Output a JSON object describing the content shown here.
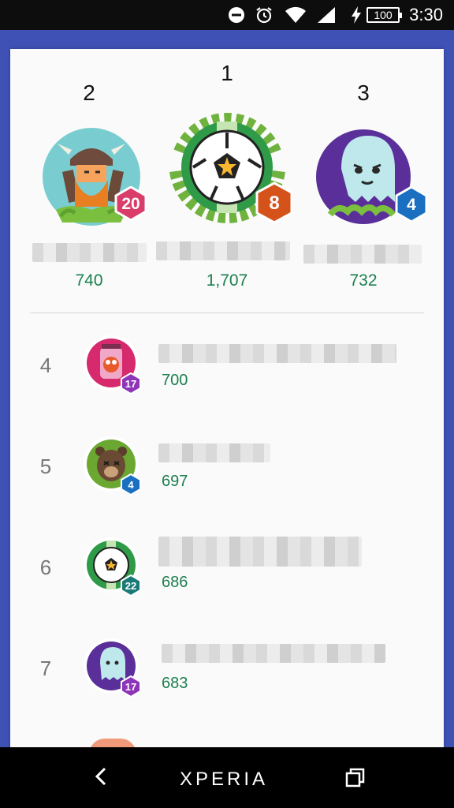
{
  "status_bar": {
    "time": "3:30",
    "battery": "100",
    "icons": [
      "do-not-disturb-icon",
      "alarm-icon",
      "wifi-icon",
      "signal-icon",
      "charging-icon"
    ]
  },
  "colors": {
    "accent": "#3f51b5",
    "score_green": "#1b7f4e",
    "badge_red": "#d93d6a",
    "badge_orange": "#d5531a",
    "badge_blue": "#1a6fc0",
    "badge_purple": "#8e34b8",
    "badge_teal": "#1a7a78"
  },
  "podium": [
    {
      "rank": "2",
      "score": "740",
      "level": "20",
      "avatar": "viking-avatar"
    },
    {
      "rank": "1",
      "score": "1,707",
      "level": "8",
      "avatar": "soccer-ball-avatar"
    },
    {
      "rank": "3",
      "score": "732",
      "level": "4",
      "avatar": "ghost-avatar"
    }
  ],
  "rows": [
    {
      "rank": "4",
      "score": "700",
      "level": "17",
      "avatar": "monster-jar-avatar"
    },
    {
      "rank": "5",
      "score": "697",
      "level": "4",
      "avatar": "bear-avatar"
    },
    {
      "rank": "6",
      "score": "686",
      "level": "22",
      "avatar": "soccer-ball-avatar"
    },
    {
      "rank": "7",
      "score": "683",
      "level": "17",
      "avatar": "ghost-avatar"
    }
  ],
  "nav": {
    "brand": "XPERIA"
  }
}
